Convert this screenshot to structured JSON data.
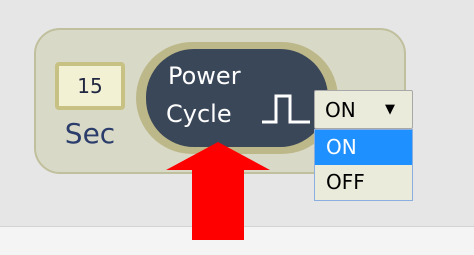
{
  "timer": {
    "value": "15",
    "unit": "Sec"
  },
  "power_cycle": {
    "line1": "Power",
    "line2": "Cycle",
    "icon": "pulse-waveform-icon"
  },
  "mode_select": {
    "selected": "ON",
    "caret": "▼",
    "options": [
      "ON",
      "OFF"
    ],
    "highlighted": "ON"
  },
  "annotation": {
    "icon": "up-arrow-icon"
  },
  "colors": {
    "button_bg": "#3a4759",
    "button_ring": "#bdb889",
    "panel_bg": "#d9d9c8",
    "timer_bg": "#f3f1d4",
    "timer_border": "#c7c184",
    "highlight": "#1e90ff",
    "arrow": "#ff0000"
  }
}
